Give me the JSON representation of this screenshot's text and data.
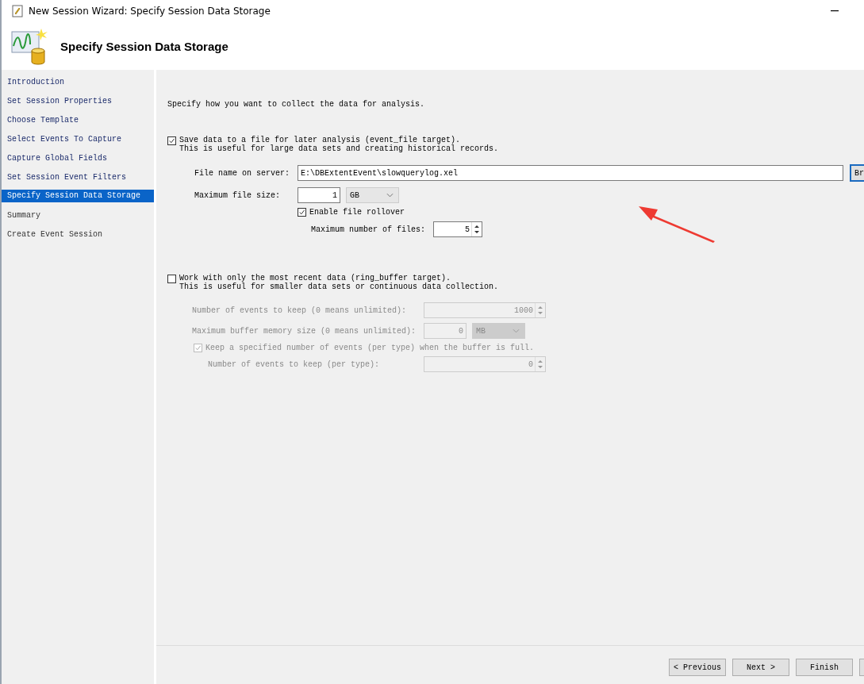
{
  "window": {
    "title": "New Session Wizard: Specify Session Data Storage"
  },
  "header": {
    "title": "Specify Session Data Storage"
  },
  "nav": [
    {
      "label": "Introduction",
      "selected": false,
      "visited": true
    },
    {
      "label": "Set Session Properties",
      "selected": false,
      "visited": true
    },
    {
      "label": "Choose Template",
      "selected": false,
      "visited": true
    },
    {
      "label": "Select Events To Capture",
      "selected": false,
      "visited": true
    },
    {
      "label": "Capture Global Fields",
      "selected": false,
      "visited": true
    },
    {
      "label": "Set Session Event Filters",
      "selected": false,
      "visited": true
    },
    {
      "label": "Specify Session Data Storage",
      "selected": true,
      "visited": true
    },
    {
      "label": "Summary",
      "selected": false,
      "visited": false
    },
    {
      "label": "Create Event Session",
      "selected": false,
      "visited": false
    }
  ],
  "intro": "Specify how you want to collect the data for analysis.",
  "file_target": {
    "checked": true,
    "label": "Save data to a file for later analysis (event_file target).",
    "description": "This is useful for large data sets and creating historical records.",
    "file_name": {
      "label": "File name on server:",
      "value": "E:\\DBExtentEvent\\slowquerylog.xel",
      "button": "Br"
    },
    "max_size": {
      "label": "Maximum file size:",
      "value": "1",
      "unit": "GB"
    },
    "rollover": {
      "checked": true,
      "label": "Enable file rollover"
    },
    "max_files": {
      "label": "Maximum number of files:",
      "value": "5"
    }
  },
  "ring_buffer": {
    "checked": false,
    "label": "Work with only the most recent data (ring_buffer target).",
    "description": "This is useful for smaller data sets or continuous data collection.",
    "events_to_keep": {
      "label": "Number of events to keep (0 means unlimited):",
      "value": "1000"
    },
    "buffer_memory": {
      "label": "Maximum buffer memory size (0 means unlimited):",
      "value": "0",
      "unit": "MB"
    },
    "keep_per_type": {
      "checked": true,
      "label": "Keep a specified number of events (per type) when the buffer is full."
    },
    "events_per_type": {
      "label": "Number of events to keep (per type):",
      "value": "0"
    }
  },
  "buttons": [
    "< Previous",
    "Next >",
    "Finish"
  ]
}
